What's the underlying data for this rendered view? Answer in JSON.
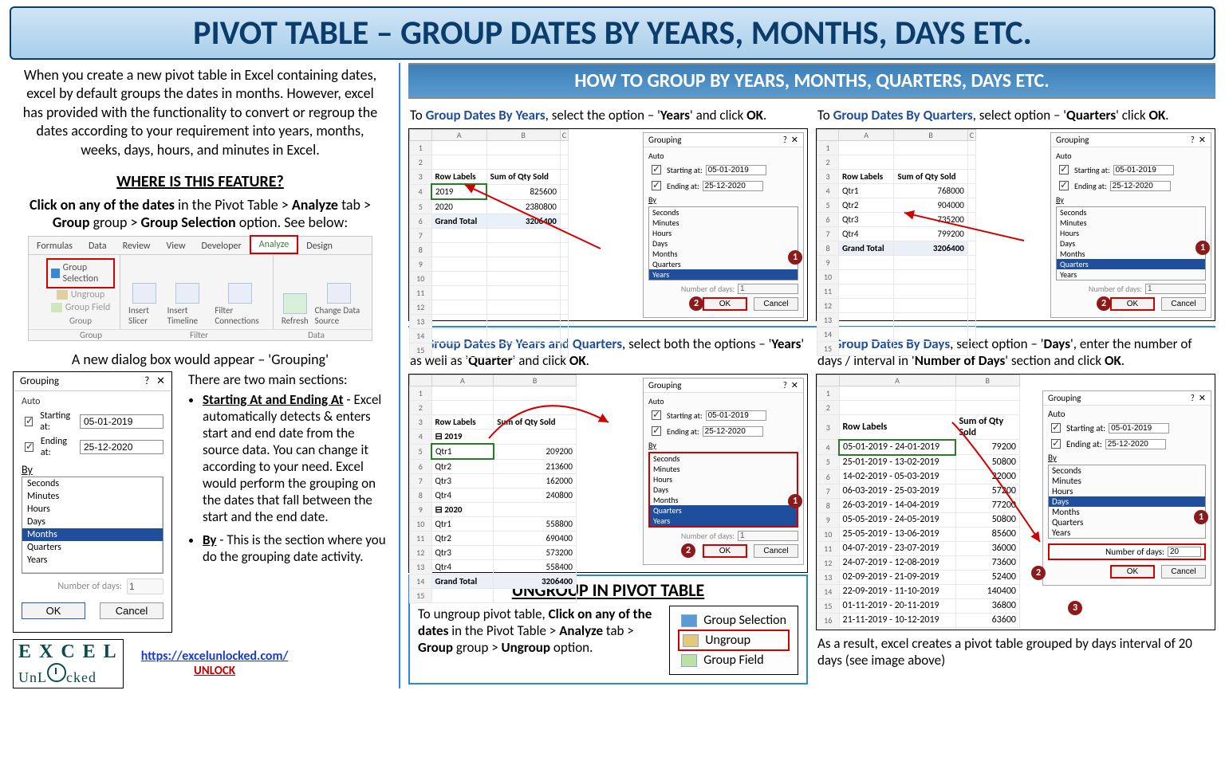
{
  "title": "PIVOT TABLE – GROUP DATES BY YEARS, MONTHS, DAYS ETC.",
  "intro": "When you create a new pivot table in Excel containing dates, excel by default groups the dates in months. However, excel has provided with the functionality to convert or regroup the dates according to your requirement into years, months, weeks, days, hours, and minutes in Excel.",
  "where_heading": "WHERE IS THIS FEATURE?",
  "where_instr_pre": "Click on any of the dates",
  "where_instr_mid": " in the Pivot Table > ",
  "where_instr_b1": "Analyze",
  "where_instr_mid2": " tab > ",
  "where_instr_b2": "Group",
  "where_instr_mid3": " group > ",
  "where_instr_b3": "Group Selection",
  "where_instr_end": " option. See below:",
  "ribbon": {
    "tabs": [
      "Formulas",
      "Data",
      "Review",
      "View",
      "Developer",
      "Analyze",
      "Design"
    ],
    "group_items": [
      "Group Selection",
      "Ungroup",
      "Group Field"
    ],
    "group_label": "Group",
    "filter_items": [
      "Insert Slicer",
      "Insert Timeline",
      "Filter Connections"
    ],
    "filter_label": "Filter",
    "data_items": [
      "Refresh",
      "Change Data Source"
    ],
    "data_label": "Data"
  },
  "caption": "A new dialog box would appear – 'Grouping'",
  "dlg": {
    "title": "Grouping",
    "auto": "Auto",
    "start_label": "Starting at:",
    "start_val": "05-01-2019",
    "end_label": "Ending at:",
    "end_val": "25-12-2020",
    "by": "By",
    "list": [
      "Seconds",
      "Minutes",
      "Hours",
      "Days",
      "Months",
      "Quarters",
      "Years"
    ],
    "numdays": "Number of days:",
    "numdays_val": "1",
    "ok": "OK",
    "cancel": "Cancel"
  },
  "sections_intro": "There are two main sections:",
  "section1_title": "Starting At and Ending At",
  "section1_body": " - Excel automatically detects & enters start and end date from the source data. You can change it according to your need. Excel would perform the grouping on the dates that fall between the start and the end date.",
  "section2_title": "By",
  "section2_body": " - This is the section where you do the grouping date activity.",
  "link": "https://excelunlocked.com/",
  "unlock": "UNLOCK",
  "right_header": "HOW TO GROUP BY YEARS, MONTHS, QUARTERS, DAYS ETC.",
  "years": {
    "head_a": "To ",
    "head_b": "Group Dates By Years",
    "head_c": ", select the option – '",
    "head_d": "Years",
    "head_e": "' and click ",
    "head_f": "OK",
    "head_g": ".",
    "rows": [
      {
        "label": "Row Labels",
        "val": "Sum of Qty Sold",
        "bold": true
      },
      {
        "label": "2019",
        "val": "825600",
        "sel": true
      },
      {
        "label": "2020",
        "val": "2380800"
      },
      {
        "label": "Grand Total",
        "val": "3206400",
        "total": true
      }
    ],
    "sel_by": "Years"
  },
  "quarters": {
    "head_a": "To ",
    "head_b": "Group Dates By Quarters",
    "head_c": ", select option – '",
    "head_d": "Quarters",
    "head_e": "' click ",
    "head_f": "OK",
    "head_g": ".",
    "rows": [
      {
        "label": "Row Labels",
        "val": "Sum of Qty Sold",
        "bold": true
      },
      {
        "label": "Qtr1",
        "val": "768000"
      },
      {
        "label": "Qtr2",
        "val": "904000"
      },
      {
        "label": "Qtr3",
        "val": "735200"
      },
      {
        "label": "Qtr4",
        "val": "799200"
      },
      {
        "label": "Grand Total",
        "val": "3206400",
        "total": true
      }
    ],
    "sel_by": "Quarters"
  },
  "yq": {
    "head_a": "To ",
    "head_b": "Group Dates By Years and Quarters",
    "head_c": ", select both the options – '",
    "head_d": "Years",
    "head_e": "' as well as '",
    "head_f": "Quarter",
    "head_g": "' and click ",
    "head_h": "OK",
    "head_i": ".",
    "rows": [
      {
        "label": "Row Labels",
        "val": "Sum of Qty Sold",
        "bold": true
      },
      {
        "label": "⊟ 2019",
        "val": "",
        "bold": true
      },
      {
        "label": "   Qtr1",
        "val": "209200",
        "sel": true
      },
      {
        "label": "   Qtr2",
        "val": "213600"
      },
      {
        "label": "   Qtr3",
        "val": "162000"
      },
      {
        "label": "   Qtr4",
        "val": "240800"
      },
      {
        "label": "⊟ 2020",
        "val": "",
        "bold": true
      },
      {
        "label": "   Qtr1",
        "val": "558800"
      },
      {
        "label": "   Qtr2",
        "val": "690400"
      },
      {
        "label": "   Qtr3",
        "val": "573200"
      },
      {
        "label": "   Qtr4",
        "val": "558400"
      },
      {
        "label": "Grand Total",
        "val": "3206400",
        "total": true
      }
    ],
    "sel_by": [
      "Quarters",
      "Years"
    ]
  },
  "days": {
    "head_a": "To ",
    "head_b": "Group Dates By Days",
    "head_c": ", select option – '",
    "head_d": "Days",
    "head_e": "', enter the number of days / interval  in '",
    "head_f": "Number of Days",
    "head_g": "' section and click ",
    "head_h": "OK",
    "head_i": ".",
    "rows": [
      {
        "label": "Row Labels",
        "val": "Sum of Qty Sold",
        "bold": true
      },
      {
        "label": "05-01-2019 - 24-01-2019",
        "val": "79200",
        "sel": true
      },
      {
        "label": "25-01-2019 - 13-02-2019",
        "val": "50800"
      },
      {
        "label": "14-02-2019 - 05-03-2019",
        "val": "22000"
      },
      {
        "label": "06-03-2019 - 25-03-2019",
        "val": "57200"
      },
      {
        "label": "26-03-2019 - 14-04-2019",
        "val": "77200"
      },
      {
        "label": "05-05-2019 - 24-05-2019",
        "val": "50800"
      },
      {
        "label": "25-05-2019 - 13-06-2019",
        "val": "85600"
      },
      {
        "label": "04-07-2019 - 23-07-2019",
        "val": "36000"
      },
      {
        "label": "24-07-2019 - 12-08-2019",
        "val": "73600"
      },
      {
        "label": "02-09-2019 - 21-09-2019",
        "val": "52400"
      },
      {
        "label": "22-09-2019 - 11-10-2019",
        "val": "140400"
      },
      {
        "label": "01-11-2019 - 20-11-2019",
        "val": "36800"
      },
      {
        "label": "21-11-2019 - 10-12-2019",
        "val": "63600"
      }
    ],
    "numdays_val": "20",
    "sel_by": "Days",
    "result": "As a result, excel creates a pivot table grouped by days interval of 20 days (see image above)"
  },
  "ungroup": {
    "title": "UNGROUP IN PIVOT TABLE",
    "text_a": "To ungroup pivot table, ",
    "text_b": "Click on any of the dates",
    "text_c": " in the Pivot Table > ",
    "text_d": "Analyze",
    "text_e": " tab > ",
    "text_f": "Group",
    "text_g": " group > ",
    "text_h": "Ungroup",
    "text_i": " option.",
    "items": [
      "Group Selection",
      "Ungroup",
      "Group Field"
    ]
  },
  "logo": {
    "line1": "E X C E L",
    "line2": "UnL   cked"
  }
}
